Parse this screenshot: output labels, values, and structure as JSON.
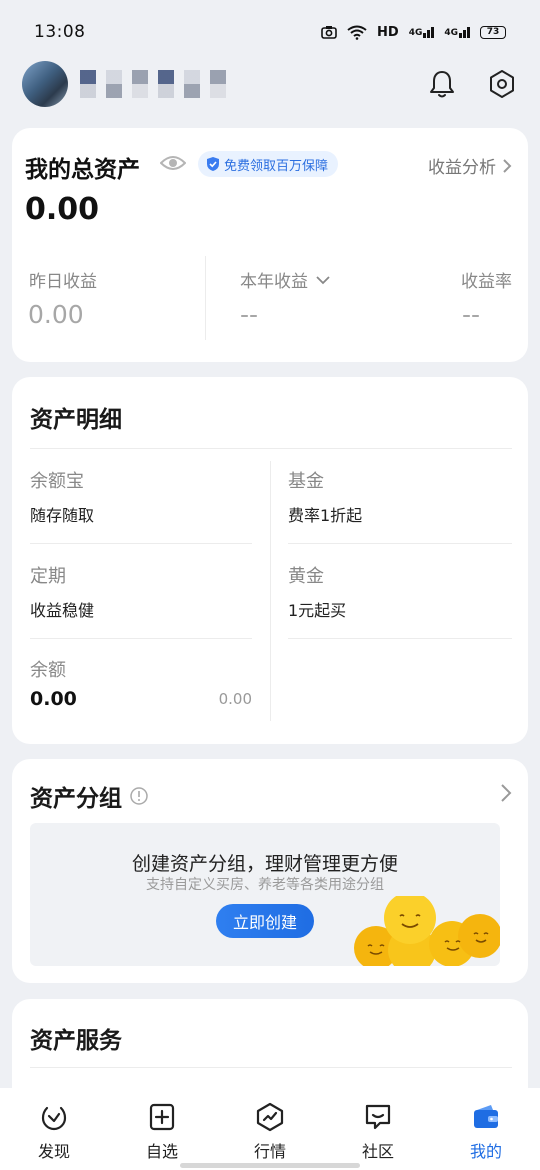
{
  "status_bar": {
    "time": "13:08",
    "network": "HD",
    "signal1": "4G",
    "signal2": "4G",
    "battery": "73"
  },
  "header": {
    "bell_icon": "bell-icon",
    "settings_icon": "settings-icon"
  },
  "summary": {
    "title": "我的总资产",
    "badge": "免费领取百万保障",
    "analysis": "收益分析",
    "total": "0.00",
    "metrics": [
      {
        "label": "昨日收益",
        "value": "0.00"
      },
      {
        "label": "本年收益",
        "value": "--"
      },
      {
        "label": "收益率",
        "value": "--"
      }
    ]
  },
  "details": {
    "title": "资产明细",
    "items": [
      {
        "label": "余额宝",
        "sub": "随存随取"
      },
      {
        "label": "基金",
        "sub": "费率1折起"
      },
      {
        "label": "定期",
        "sub": "收益稳健"
      },
      {
        "label": "黄金",
        "sub": "1元起买"
      },
      {
        "label": "余额",
        "value": "0.00",
        "right": "0.00"
      }
    ]
  },
  "groups": {
    "title": "资产分组",
    "promo_title": "创建资产分组，理财管理更方便",
    "promo_sub": "支持自定义买房、养老等各类用途分组",
    "button": "立即创建"
  },
  "services": {
    "title": "资产服务"
  },
  "tabbar": {
    "tabs": [
      {
        "label": "发现",
        "icon": "discover-icon"
      },
      {
        "label": "自选",
        "icon": "add-square-icon"
      },
      {
        "label": "行情",
        "icon": "market-icon"
      },
      {
        "label": "社区",
        "icon": "community-icon"
      },
      {
        "label": "我的",
        "icon": "wallet-icon"
      }
    ],
    "active_color": "#1f6de3"
  }
}
